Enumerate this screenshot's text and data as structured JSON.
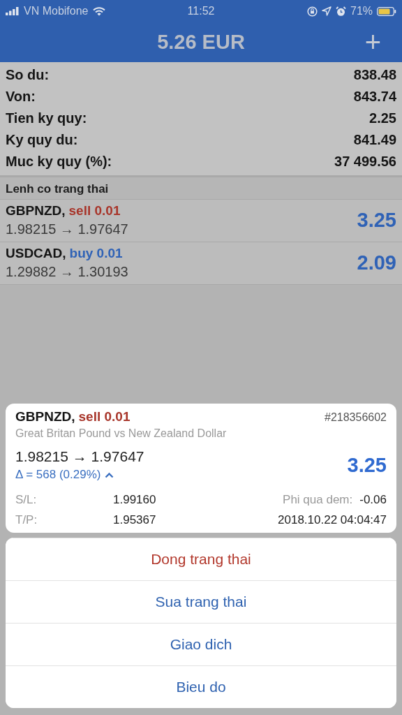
{
  "status_bar": {
    "carrier": "VN Mobifone",
    "time": "11:52",
    "battery": "71%"
  },
  "header": {
    "title": "5.26 EUR",
    "add": "+"
  },
  "summary": [
    {
      "label": "So du:",
      "value": "838.48"
    },
    {
      "label": "Von:",
      "value": "843.74"
    },
    {
      "label": "Tien ky quy:",
      "value": "2.25"
    },
    {
      "label": "Ky quy du:",
      "value": "841.49"
    },
    {
      "label": "Muc ky quy (%):",
      "value": "37 499.56"
    }
  ],
  "positions": {
    "title": "Lenh co trang thai",
    "orders": [
      {
        "symbol": "GBPNZD,",
        "kind": "sell",
        "action": "sell 0.01",
        "prices": "1.98215 → 1.97647",
        "profit": "3.25"
      },
      {
        "symbol": "USDCAD,",
        "kind": "buy",
        "action": "buy 0.01",
        "prices": "1.29882 → 1.30193",
        "profit": "2.09"
      }
    ]
  },
  "order_card": {
    "symbol": "GBPNZD,",
    "kind": "sell",
    "action": "sell 0.01",
    "ticket": "#218356602",
    "description": "Great Britan Pound vs New Zealand Dollar",
    "prices": "1.98215 → 1.97647",
    "delta": "Δ = 568 (0.29%)",
    "profit": "3.25",
    "details": [
      {
        "label": "S/L:",
        "value": "1.99160",
        "label_2": "Phi qua dem:",
        "value_2": "-0.06"
      },
      {
        "label": "T/P:",
        "value": "1.95367",
        "value_2": "2018.10.22 04:04:47"
      }
    ]
  },
  "action_sheet": [
    {
      "label": "Dong trang thai",
      "kind": "destructive"
    },
    {
      "label": "Sua trang thai",
      "kind": "default"
    },
    {
      "label": "Giao dich",
      "kind": "default"
    },
    {
      "label": "Bieu do",
      "kind": "default"
    }
  ]
}
